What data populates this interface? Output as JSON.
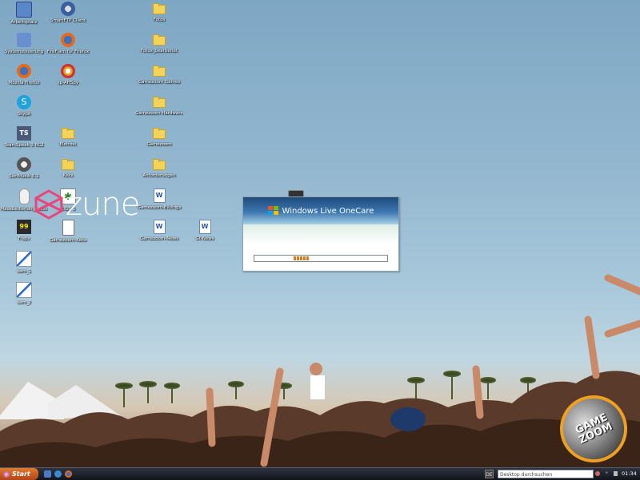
{
  "desktop": {
    "icons_col1": [
      {
        "label": "Arbeitsplatz",
        "icon": "computer-icon"
      },
      {
        "label": "Systemsteuerung",
        "icon": "control-panel-icon"
      },
      {
        "label": "Mozilla Firefox",
        "icon": "firefox-icon"
      },
      {
        "label": "Skype",
        "icon": "skype-icon"
      },
      {
        "label": "TeamSpeak 3 RC2",
        "icon": "teamspeak-icon"
      },
      {
        "label": "SurfMusik 5.1",
        "icon": "surfmusik-icon"
      },
      {
        "label": "Mausbedienung_desk",
        "icon": "mouse-icon"
      },
      {
        "label": "Fraps",
        "icon": "fraps-icon"
      },
      {
        "label": "sam_1",
        "icon": "paint-icon"
      },
      {
        "label": "sam_2",
        "icon": "paint-icon"
      }
    ],
    "icons_col2": [
      {
        "label": "SmartFTP Client",
        "icon": "smartftp-icon"
      },
      {
        "label": "FireFlam für Firefox",
        "icon": "fireflam-icon"
      },
      {
        "label": "sp-AHSpy",
        "icon": "spy-icon"
      },
      {
        "label": "Eletrost",
        "icon": "folder-icon"
      },
      {
        "label": "Keks",
        "icon": "folder-icon"
      },
      {
        "label": "EIGS 3",
        "icon": "eigs-icon"
      },
      {
        "label": "Gamezoom-Keks",
        "icon": "document-icon"
      }
    ],
    "icons_col3": [
      {
        "label": "Fotos",
        "icon": "folder-icon"
      },
      {
        "label": "Fotos_bearbeitet",
        "icon": "folder-icon"
      },
      {
        "label": "Gamezoom Games",
        "icon": "folder-icon"
      },
      {
        "label": "Gamezoom Hardware",
        "icon": "folder-icon"
      },
      {
        "label": "Gamezoom",
        "icon": "folder-icon"
      },
      {
        "label": "Anforderungen",
        "icon": "folder-icon"
      },
      {
        "label": "Gamezoom-Bildings",
        "icon": "word-doc-icon"
      },
      {
        "label": "Gamezoom-News",
        "icon": "word-doc-icon"
      }
    ],
    "icons_col4": [
      {
        "label": "Gt-News",
        "icon": "word-doc-icon"
      }
    ]
  },
  "zune": {
    "logo_text": "zune"
  },
  "splash": {
    "title": "Windows Live OneCare",
    "progress": 0.12
  },
  "taskbar": {
    "start_label": "Start",
    "search_placeholder": "Desktop durchsuchen",
    "clock": "01:34"
  },
  "watermark": {
    "line1": "GAME",
    "line2": "ZOOM"
  }
}
